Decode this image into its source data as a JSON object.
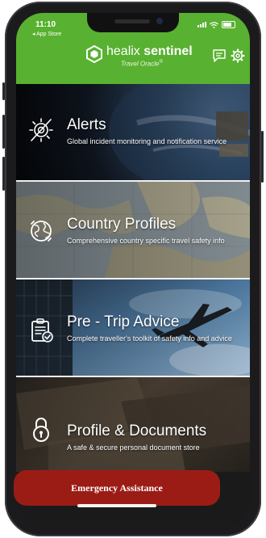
{
  "status_bar": {
    "time": "11:10",
    "back_label": "◂ App Store"
  },
  "header": {
    "brand_light": "healix ",
    "brand_bold": "sentinel",
    "tagline": "Travel Oracle",
    "tagline_mark": "®"
  },
  "icons": {
    "logo": "healix-hex-logo-icon",
    "messages": "chat-icon",
    "settings": "gear-icon"
  },
  "tiles": [
    {
      "title": "Alerts",
      "description": "Global incident monitoring and notification service",
      "icon": "alert-radar-icon"
    },
    {
      "title": "Country Profiles",
      "description": "Comprehensive country specific travel safety info",
      "icon": "globe-icon"
    },
    {
      "title": "Pre - Trip Advice",
      "description": "Complete traveller's toolkit of safety info and advice",
      "icon": "clipboard-check-icon"
    },
    {
      "title": "Profile & Documents",
      "description": "A safe & secure personal document store",
      "icon": "padlock-icon"
    }
  ],
  "emergency": {
    "label": "Emergency Assistance"
  },
  "colors": {
    "header": "#58b130",
    "emergency": "#9b1c15"
  }
}
